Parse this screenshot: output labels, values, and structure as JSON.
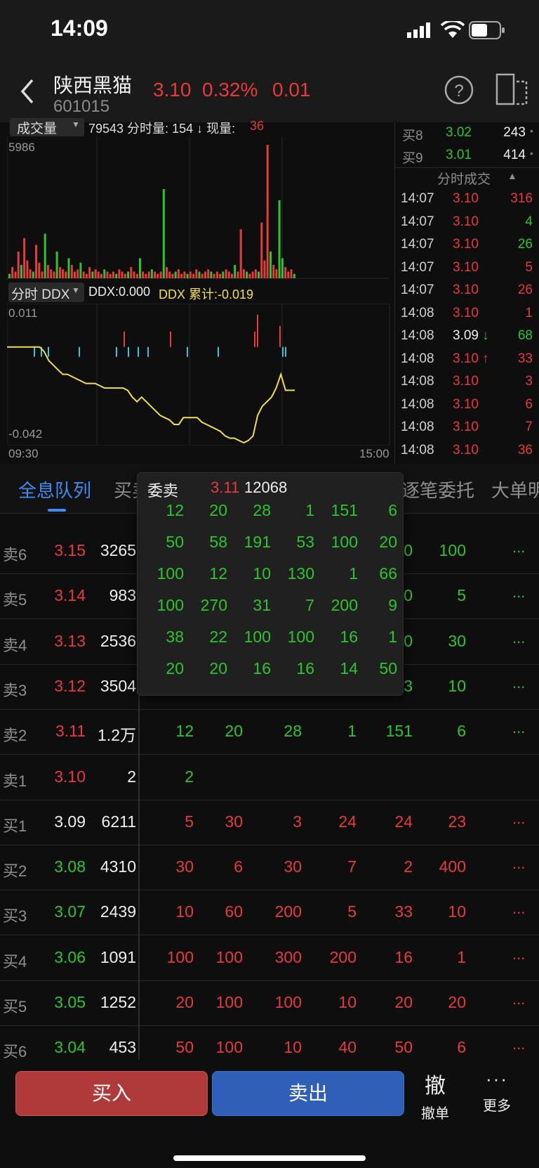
{
  "status_bar": {
    "time": "14:09"
  },
  "header": {
    "stock_name": "陕西黑猫",
    "stock_code": "601015",
    "price": "3.10",
    "change_pct": "0.32%",
    "change": "0.01",
    "colors": {
      "up": "#e83a3a",
      "down": "#2cc52c"
    }
  },
  "volume_panel": {
    "title": "成交量",
    "info": "79543 分时量: 154 ↓ 现量: ",
    "current_vol": "36",
    "max_label": "5986"
  },
  "ddx_panel": {
    "title": "分时 DDX",
    "ddx": "DDX:0.000",
    "ddx_cum": "DDX 累计:-0.019",
    "top_label": "0.011",
    "bottom_label": "-0.042",
    "time_start": "09:30",
    "time_end": "15:00"
  },
  "order_book_top": [
    {
      "label": "买8",
      "price": "3.02",
      "vol": "243"
    },
    {
      "label": "买9",
      "price": "3.01",
      "vol": "414"
    }
  ],
  "trades_header": "分时成交",
  "trades": [
    {
      "time": "14:07",
      "price": "3.10",
      "dir": "",
      "vol": "316",
      "pc": "red",
      "vc": "red"
    },
    {
      "time": "14:07",
      "price": "3.10",
      "dir": "",
      "vol": "4",
      "pc": "red",
      "vc": "green"
    },
    {
      "time": "14:07",
      "price": "3.10",
      "dir": "",
      "vol": "26",
      "pc": "red",
      "vc": "green"
    },
    {
      "time": "14:07",
      "price": "3.10",
      "dir": "",
      "vol": "5",
      "pc": "red",
      "vc": "red"
    },
    {
      "time": "14:07",
      "price": "3.10",
      "dir": "",
      "vol": "26",
      "pc": "red",
      "vc": "red"
    },
    {
      "time": "14:08",
      "price": "3.10",
      "dir": "",
      "vol": "1",
      "pc": "red",
      "vc": "red"
    },
    {
      "time": "14:08",
      "price": "3.09",
      "dir": "↓",
      "vol": "68",
      "pc": "white",
      "vc": "green"
    },
    {
      "time": "14:08",
      "price": "3.10",
      "dir": "↑",
      "vol": "33",
      "pc": "red",
      "vc": "red"
    },
    {
      "time": "14:08",
      "price": "3.10",
      "dir": "",
      "vol": "3",
      "pc": "red",
      "vc": "red"
    },
    {
      "time": "14:08",
      "price": "3.10",
      "dir": "",
      "vol": "6",
      "pc": "red",
      "vc": "red"
    },
    {
      "time": "14:08",
      "price": "3.10",
      "dir": "",
      "vol": "7",
      "pc": "red",
      "vc": "red"
    },
    {
      "time": "14:08",
      "price": "3.10",
      "dir": "",
      "vol": "36",
      "pc": "red",
      "vc": "red"
    }
  ],
  "tabs": [
    "全息队列",
    "买卖",
    "逐笔委托",
    "大单明"
  ],
  "popup": {
    "title": "委卖",
    "price": "3.11",
    "volume": "12068",
    "rows": [
      [
        "12",
        "20",
        "28",
        "1",
        "151",
        "6"
      ],
      [
        "50",
        "58",
        "191",
        "53",
        "100",
        "20"
      ],
      [
        "100",
        "12",
        "10",
        "130",
        "1",
        "66"
      ],
      [
        "100",
        "270",
        "31",
        "7",
        "200",
        "9"
      ],
      [
        "38",
        "22",
        "100",
        "100",
        "16",
        "1"
      ],
      [
        "20",
        "20",
        "16",
        "16",
        "14",
        "50"
      ]
    ]
  },
  "queue": [
    {
      "label": "卖6",
      "price": "3.15",
      "pc": "red",
      "vol": "3265",
      "qc": "green",
      "q": [
        "",
        "",
        "",
        "",
        "10",
        "100"
      ],
      "more": "..."
    },
    {
      "label": "卖5",
      "price": "3.14",
      "pc": "red",
      "vol": "983",
      "qc": "green",
      "q": [
        "",
        "",
        "",
        "",
        "30",
        "5"
      ],
      "more": "..."
    },
    {
      "label": "卖4",
      "price": "3.13",
      "pc": "red",
      "vol": "2536",
      "qc": "green",
      "q": [
        "",
        "",
        "",
        "",
        "40",
        "30"
      ],
      "more": "..."
    },
    {
      "label": "卖3",
      "price": "3.12",
      "pc": "red",
      "vol": "3504",
      "qc": "green",
      "q": [
        "",
        "",
        "",
        "",
        "13",
        "10"
      ],
      "more": "..."
    },
    {
      "label": "卖2",
      "price": "3.11",
      "pc": "red",
      "vol": "1.2万",
      "qc": "green",
      "q": [
        "12",
        "20",
        "28",
        "1",
        "151",
        "6"
      ],
      "more": "..."
    },
    {
      "label": "卖1",
      "price": "3.10",
      "pc": "red",
      "vol": "2",
      "qc": "green",
      "q": [
        "2",
        "",
        "",
        "",
        "",
        ""
      ],
      "more": ""
    },
    {
      "label": "买1",
      "price": "3.09",
      "pc": "white",
      "vol": "6211",
      "qc": "red",
      "q": [
        "5",
        "30",
        "3",
        "24",
        "24",
        "23"
      ],
      "more": "..."
    },
    {
      "label": "买2",
      "price": "3.08",
      "pc": "green",
      "vol": "4310",
      "qc": "red",
      "q": [
        "30",
        "6",
        "30",
        "7",
        "2",
        "400"
      ],
      "more": "..."
    },
    {
      "label": "买3",
      "price": "3.07",
      "pc": "green",
      "vol": "2439",
      "qc": "red",
      "q": [
        "10",
        "60",
        "200",
        "5",
        "33",
        "10"
      ],
      "more": "..."
    },
    {
      "label": "买4",
      "price": "3.06",
      "pc": "green",
      "vol": "1091",
      "qc": "red",
      "q": [
        "100",
        "100",
        "300",
        "200",
        "16",
        "1"
      ],
      "more": "..."
    },
    {
      "label": "买5",
      "price": "3.05",
      "pc": "green",
      "vol": "1252",
      "qc": "red",
      "q": [
        "20",
        "100",
        "100",
        "10",
        "20",
        "20"
      ],
      "more": "..."
    },
    {
      "label": "买6",
      "price": "3.04",
      "pc": "green",
      "vol": "453",
      "qc": "red",
      "q": [
        "50",
        "100",
        "10",
        "40",
        "50",
        "6"
      ],
      "more": "..."
    }
  ],
  "bottom_bar": {
    "buy": "买入",
    "sell": "卖出",
    "cancel_icon": "撤",
    "cancel": "撤单",
    "more_icon": "···",
    "more": "更多",
    "buy_color": "#b03a3a",
    "sell_color": "#2f5fb7"
  },
  "chart_data": [
    {
      "type": "bar",
      "title": "成交量",
      "ylim": [
        0,
        5986
      ],
      "values": [
        200,
        500,
        300,
        1200,
        600,
        1800,
        800,
        400,
        300,
        1500,
        700,
        300,
        2000,
        600,
        400,
        300,
        1200,
        500,
        400,
        300,
        900,
        600,
        300,
        400,
        700,
        300,
        200,
        500,
        300,
        400,
        300,
        200,
        400,
        300,
        200,
        300,
        200,
        400,
        300,
        200,
        300,
        500,
        300,
        200,
        900,
        300,
        200,
        300,
        400,
        300,
        200,
        300,
        4000,
        500,
        300,
        200,
        300,
        400,
        200,
        300,
        200,
        300,
        200,
        400,
        300,
        200,
        300,
        400,
        300,
        200,
        300,
        200,
        300,
        400,
        300,
        200,
        600,
        300,
        2200,
        400,
        300,
        200,
        300,
        400,
        300,
        2500,
        800,
        5986,
        1200,
        600,
        400,
        3500,
        900,
        500,
        300,
        400,
        200
      ]
    },
    {
      "type": "line",
      "title": "分时 DDX",
      "ylim": [
        -0.042,
        0.011
      ],
      "values": [
        0,
        0,
        0,
        0,
        0,
        0,
        0,
        0,
        -0.002,
        -0.006,
        -0.008,
        -0.01,
        -0.012,
        -0.012,
        -0.013,
        -0.014,
        -0.015,
        -0.016,
        -0.016,
        -0.016,
        -0.017,
        -0.018,
        -0.018,
        -0.018,
        -0.018,
        -0.018,
        -0.019,
        -0.022,
        -0.024,
        -0.022,
        -0.024,
        -0.026,
        -0.028,
        -0.03,
        -0.031,
        -0.032,
        -0.034,
        -0.034,
        -0.031,
        -0.031,
        -0.031,
        -0.031,
        -0.033,
        -0.034,
        -0.035,
        -0.036,
        -0.037,
        -0.039,
        -0.04,
        -0.04,
        -0.041,
        -0.042,
        -0.041,
        -0.039,
        -0.03,
        -0.026,
        -0.024,
        -0.022,
        -0.018,
        -0.012,
        -0.019,
        -0.019,
        -0.019
      ]
    }
  ]
}
